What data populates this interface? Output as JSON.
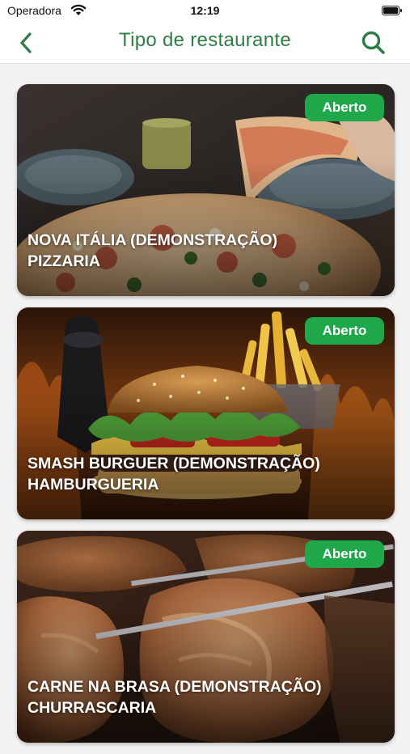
{
  "status_bar": {
    "carrier": "Operadora",
    "time": "12:19"
  },
  "nav": {
    "title": "Tipo de restaurante"
  },
  "restaurants": [
    {
      "name": "NOVA ITÁLIA (DEMONSTRAÇÃO)",
      "category": "PIZZARIA",
      "status": "Aberto"
    },
    {
      "name": "SMASH BURGUER (DEMONSTRAÇÃO)",
      "category": "HAMBURGUERIA",
      "status": "Aberto"
    },
    {
      "name": "CARNE NA BRASA (DEMONSTRAÇÃO)",
      "category": "CHURRASCARIA",
      "status": "Aberto"
    }
  ],
  "colors": {
    "accent": "#2e7d43",
    "badge": "#1fa84a",
    "background": "#f2f2f2"
  },
  "icons": {
    "back": "chevron-left-icon",
    "search": "search-icon"
  }
}
